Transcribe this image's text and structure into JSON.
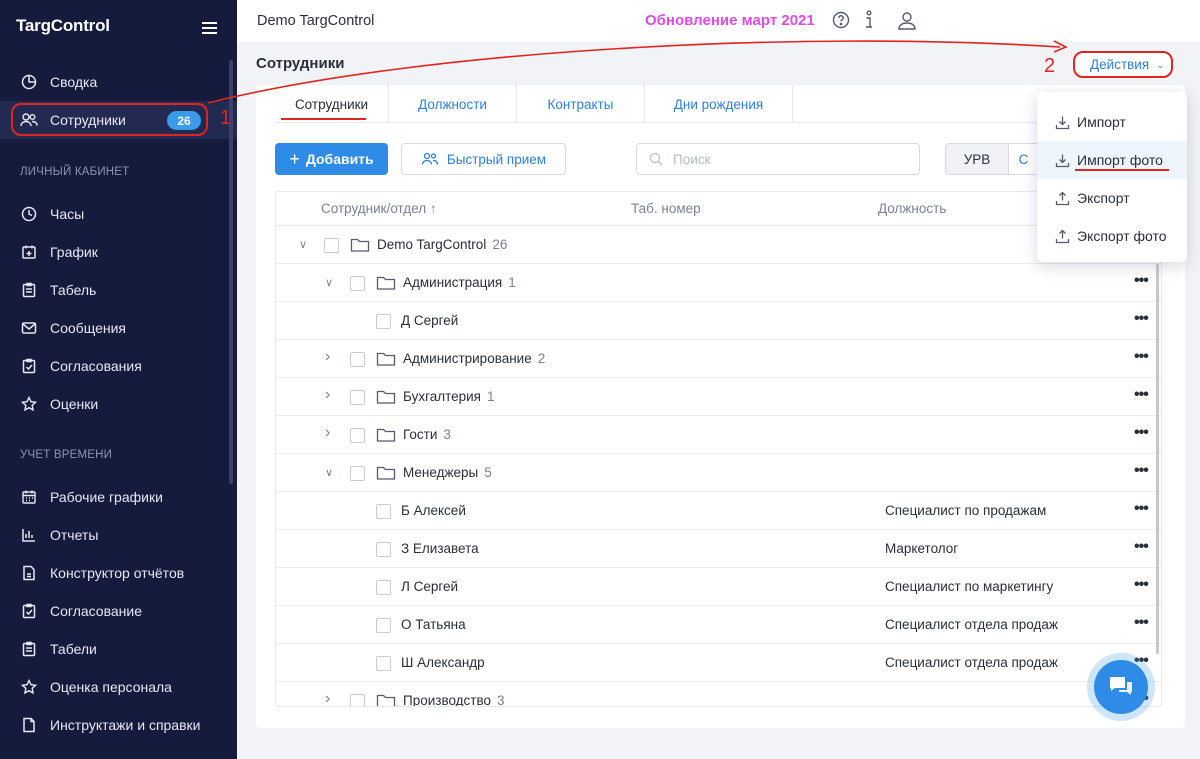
{
  "sidebar": {
    "logo": "TargControl",
    "items_top": [
      {
        "label": "Сводка",
        "icon": "pie-chart-icon"
      },
      {
        "label": "Сотрудники",
        "icon": "users-icon",
        "badge": "26",
        "active": true
      }
    ],
    "section_personal": "ЛИЧНЫЙ КАБИНЕТ",
    "items_personal": [
      {
        "label": "Часы",
        "icon": "clock-icon"
      },
      {
        "label": "График",
        "icon": "calendar-plus-icon"
      },
      {
        "label": "Табель",
        "icon": "clipboard-icon"
      },
      {
        "label": "Сообщения",
        "icon": "mail-icon"
      },
      {
        "label": "Согласования",
        "icon": "clipboard-check-icon"
      },
      {
        "label": "Оценки",
        "icon": "star-icon"
      }
    ],
    "section_time": "УЧЕТ ВРЕМЕНИ",
    "items_time": [
      {
        "label": "Рабочие графики",
        "icon": "calendar-grid-icon"
      },
      {
        "label": "Отчеты",
        "icon": "bar-chart-icon"
      },
      {
        "label": "Конструктор отчётов",
        "icon": "document-icon"
      },
      {
        "label": "Согласование",
        "icon": "clipboard-check-icon"
      },
      {
        "label": "Табели",
        "icon": "table-icon"
      },
      {
        "label": "Оценка персонала",
        "icon": "star-icon"
      },
      {
        "label": "Инструктажи и справки",
        "icon": "file-icon"
      }
    ]
  },
  "annotations": {
    "one": "1",
    "two": "2"
  },
  "header": {
    "title": "Demo TargControl",
    "update": "Обновление март 2021"
  },
  "page": {
    "title": "Сотрудники",
    "actions_label": "Действия"
  },
  "tabs": [
    "Сотрудники",
    "Должности",
    "Контракты",
    "Дни рождения"
  ],
  "toolbar": {
    "add_label": "Добавить",
    "quick_label": "Быстрый прием",
    "search_placeholder": "Поиск",
    "seg1": "УРВ",
    "seg2": "С"
  },
  "table": {
    "headers": {
      "employee": "Сотрудник/отдел ↑",
      "tab_num": "Таб. номер",
      "position": "Должность"
    },
    "rows": [
      {
        "name": "Demo TargControl",
        "count": "26",
        "level": 0,
        "type": "folder",
        "expand": "down",
        "position": ""
      },
      {
        "name": "Администрация",
        "count": "1",
        "level": 1,
        "type": "folder",
        "expand": "down",
        "position": ""
      },
      {
        "name": "Д Сергей",
        "count": "",
        "level": 2,
        "type": "person",
        "expand": "",
        "position": ""
      },
      {
        "name": "Администрирование",
        "count": "2",
        "level": 1,
        "type": "folder",
        "expand": "right",
        "position": ""
      },
      {
        "name": "Бухгалтерия",
        "count": "1",
        "level": 1,
        "type": "folder",
        "expand": "right",
        "position": ""
      },
      {
        "name": "Гости",
        "count": "3",
        "level": 1,
        "type": "folder",
        "expand": "right",
        "position": ""
      },
      {
        "name": "Менеджеры",
        "count": "5",
        "level": 1,
        "type": "folder",
        "expand": "down",
        "position": ""
      },
      {
        "name": "Б Алексей",
        "count": "",
        "level": 2,
        "type": "person",
        "expand": "",
        "position": "Специалист по продажам"
      },
      {
        "name": "З Елизавета",
        "count": "",
        "level": 2,
        "type": "person",
        "expand": "",
        "position": "Маркетолог"
      },
      {
        "name": "Л Сергей",
        "count": "",
        "level": 2,
        "type": "person",
        "expand": "",
        "position": "Специалист по маркетингу"
      },
      {
        "name": "О Татьяна",
        "count": "",
        "level": 2,
        "type": "person",
        "expand": "",
        "position": "Специалист отдела продаж"
      },
      {
        "name": "Ш Александр",
        "count": "",
        "level": 2,
        "type": "person",
        "expand": "",
        "position": "Специалист отдела продаж"
      },
      {
        "name": "Производство",
        "count": "3",
        "level": 1,
        "type": "folder",
        "expand": "right",
        "position": ""
      }
    ]
  },
  "dropdown": [
    {
      "label": "Импорт",
      "icon": "download-icon"
    },
    {
      "label": "Импорт фото",
      "icon": "download-icon",
      "hover": true
    },
    {
      "label": "Экспорт",
      "icon": "upload-icon"
    },
    {
      "label": "Экспорт фото",
      "icon": "upload-icon"
    }
  ],
  "colors": {
    "accent": "#2e8be6",
    "sidebar": "#151b3d",
    "annotation": "#e0251f",
    "update": "#e04ce3"
  }
}
